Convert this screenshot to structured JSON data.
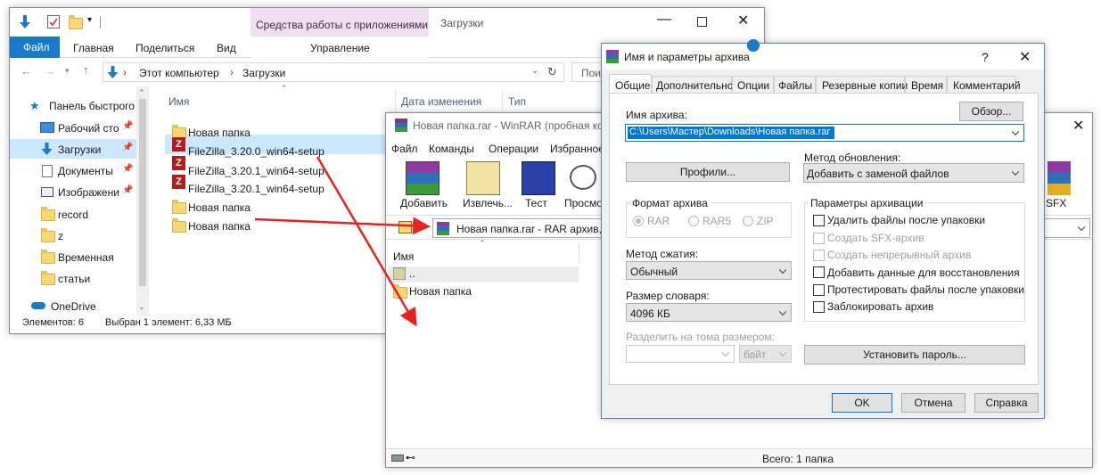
{
  "explorer": {
    "ribbon_context_header": "Средства работы с приложениями",
    "title": "Загрузки",
    "tabs": [
      "Файл",
      "Главная",
      "Поделиться",
      "Вид"
    ],
    "context_tab": "Управление",
    "address": {
      "root": "Этот компьютер",
      "folder": "Загрузки"
    },
    "search_placeholder": "Пои",
    "columns": {
      "name": "Имя",
      "date": "Дата изменения",
      "type": "Тип"
    },
    "nav": {
      "quick_access": "Панель быстрого",
      "items": [
        {
          "label": "Рабочий сто",
          "icon": "desktop-icon"
        },
        {
          "label": "Загрузки",
          "icon": "download-arrow-icon"
        },
        {
          "label": "Документы",
          "icon": "documents-icon"
        },
        {
          "label": "Изображени",
          "icon": "pictures-icon"
        },
        {
          "label": "record",
          "icon": "folder-icon"
        },
        {
          "label": "z",
          "icon": "folder-icon"
        },
        {
          "label": "Временная",
          "icon": "folder-icon"
        },
        {
          "label": "статьи",
          "icon": "folder-icon"
        }
      ],
      "onedrive": "OneDrive"
    },
    "files": [
      {
        "name": "Новая папка",
        "icon": "folder-icon"
      },
      {
        "name": "FileZilla_3.20.0_win64-setup",
        "icon": "filezilla-icon"
      },
      {
        "name": "FileZilla_3.20.1_win64-setup",
        "icon": "filezilla-icon"
      },
      {
        "name": "FileZilla_3.20.1_win64-setup",
        "icon": "filezilla-icon"
      },
      {
        "name": "Новая папка",
        "icon": "folder-icon"
      },
      {
        "name": "Новая папка",
        "icon": "folder-icon"
      }
    ],
    "status": {
      "count": "Элементов: 6",
      "selected": "Выбран 1 элемент: 6,33 МБ"
    }
  },
  "winrar": {
    "title": "Новая папка.rar - WinRAR (пробная копия)",
    "menu": [
      "Файл",
      "Команды",
      "Операции",
      "Избранное"
    ],
    "toolbar": [
      "Добавить",
      "Извлечь...",
      "Тест",
      "Просмотр",
      "SFX"
    ],
    "path": "Новая папка.rar - RAR архив, р",
    "column_name": "Имя",
    "rows": [
      "..",
      "Новая папка"
    ],
    "status": "Всего: 1 папка"
  },
  "dialog": {
    "title": "Имя и параметры архива",
    "help": "?",
    "tabs": [
      "Общие",
      "Дополнительно",
      "Опции",
      "Файлы",
      "Резервные копии",
      "Время",
      "Комментарий"
    ],
    "archive_name_label": "Имя архива:",
    "browse_button": "Обзор...",
    "archive_name_value": "C:\\Users\\Мастер\\Downloads\\Новая папка.rar",
    "profiles_button": "Профили...",
    "update_method_label": "Метод обновления:",
    "update_method_value": "Добавить с заменой файлов",
    "format_label": "Формат архива",
    "formats": [
      {
        "label": "RAR",
        "checked": true
      },
      {
        "label": "RAR5",
        "checked": false
      },
      {
        "label": "ZIP",
        "checked": false
      }
    ],
    "compression_label": "Метод сжатия:",
    "compression_value": "Обычный",
    "dict_label": "Размер словаря:",
    "dict_value": "4096 КБ",
    "split_label": "Разделить на тома размером:",
    "split_value": "",
    "split_unit": "байт",
    "params_label": "Параметры архивации",
    "options": [
      {
        "label": "Удалить файлы после упаковки",
        "enabled": true,
        "checked": false
      },
      {
        "label": "Создать SFX-архив",
        "enabled": false,
        "checked": false
      },
      {
        "label": "Создать непрерывный архив",
        "enabled": false,
        "checked": false
      },
      {
        "label": "Добавить данные для восстановления",
        "enabled": true,
        "checked": false
      },
      {
        "label": "Протестировать файлы после упаковки",
        "enabled": true,
        "checked": false
      },
      {
        "label": "Заблокировать архив",
        "enabled": true,
        "checked": false
      }
    ],
    "password_button": "Установить пароль...",
    "ok_button": "OK",
    "cancel_button": "Отмена",
    "help_button": "Справка"
  },
  "colors": {
    "accent": "#1979ca",
    "selection": "#cce8ff",
    "arrow": "#e8231f"
  }
}
